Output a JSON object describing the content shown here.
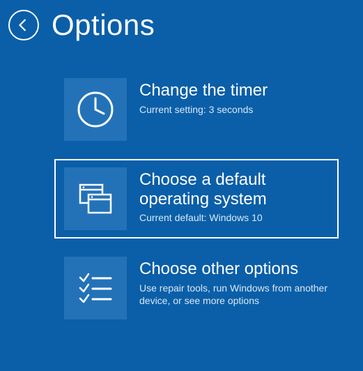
{
  "header": {
    "title": "Options"
  },
  "options": [
    {
      "title": "Change the timer",
      "subtitle": "Current setting: 3 seconds",
      "icon": "clock-icon",
      "selected": false
    },
    {
      "title": "Choose a default operating system",
      "subtitle": "Current default: Windows 10",
      "icon": "windows-icon",
      "selected": true
    },
    {
      "title": "Choose other options",
      "subtitle": "Use repair tools, run Windows from another device, or see more options",
      "icon": "checklist-icon",
      "selected": false
    }
  ]
}
